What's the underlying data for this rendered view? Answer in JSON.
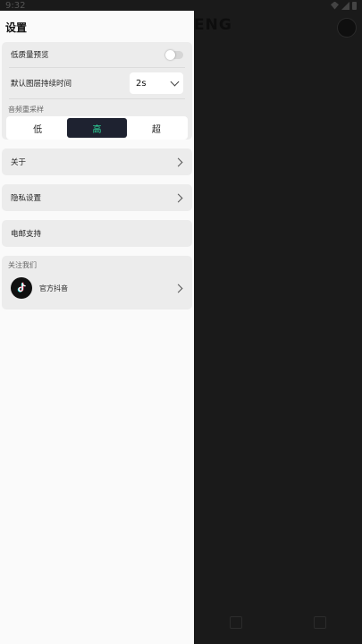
{
  "status": {
    "time": "9:32"
  },
  "background": {
    "logo_text": "ENG",
    "tabs": [
      "",
      ""
    ]
  },
  "drawer": {
    "title": "设置",
    "low_quality_preview": {
      "label": "低质量预览",
      "enabled": false
    },
    "default_layer_duration": {
      "label": "默认图层持续时间",
      "value": "2s"
    },
    "audio_resample": {
      "label": "音频重采样",
      "options": [
        "低",
        "高",
        "超"
      ],
      "selected": "高"
    },
    "about": {
      "label": "关于"
    },
    "privacy": {
      "label": "隐私设置"
    },
    "email_support": {
      "label": "电邮支持"
    },
    "follow_us": {
      "label": "关注我们",
      "official_douyin": "官方抖音"
    }
  },
  "colors": {
    "accent": "#2fe0a0",
    "segment_active_bg": "#1e2230",
    "drawer_bg": "#fafafa",
    "card_bg": "#ececec"
  }
}
